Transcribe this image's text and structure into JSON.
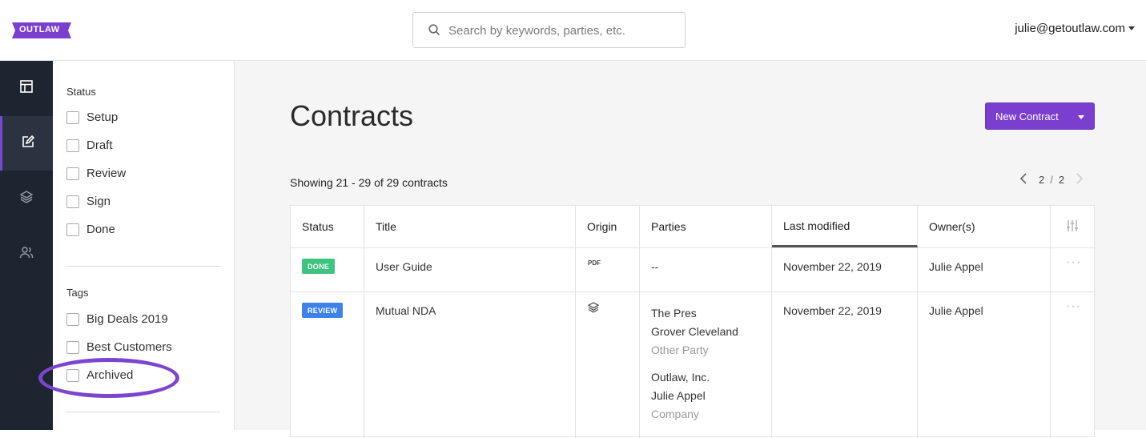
{
  "brand": {
    "name": "OUTLAW",
    "color": "#7b3fd0"
  },
  "search": {
    "placeholder": "Search by keywords, parties, etc.",
    "icon": "search-icon"
  },
  "user": {
    "email": "julie@getoutlaw.com"
  },
  "rail": {
    "items": [
      {
        "icon": "dashboard-icon"
      },
      {
        "icon": "edit-icon",
        "active": true
      },
      {
        "icon": "layers-icon"
      },
      {
        "icon": "users-icon"
      }
    ]
  },
  "filters": {
    "status_title": "Status",
    "status": [
      "Setup",
      "Draft",
      "Review",
      "Sign",
      "Done"
    ],
    "tags_title": "Tags",
    "tags": [
      "Big Deals 2019",
      "Best Customers",
      "Archived"
    ]
  },
  "main": {
    "title": "Contracts",
    "new_button": "New Contract",
    "showing": "Showing 21 - 29 of 29 contracts",
    "page_current": "2",
    "page_sep": "/",
    "page_total": "2"
  },
  "table": {
    "headers": {
      "status": "Status",
      "title": "Title",
      "origin": "Origin",
      "parties": "Parties",
      "modified": "Last modified",
      "owners": "Owner(s)"
    },
    "rows": [
      {
        "status": "DONE",
        "status_color": "#3ec47f",
        "title": "User Guide",
        "origin": "PDF",
        "parties": "--",
        "modified": "November 22, 2019",
        "owner": "Julie Appel"
      },
      {
        "status": "REVIEW",
        "status_color": "#3d82e8",
        "title": "Mutual NDA",
        "origin_icon": "layers-icon",
        "party1_name": "The Pres",
        "party1_person": "Grover Cleveland",
        "party1_role": "Other Party",
        "party2_name": "Outlaw, Inc.",
        "party2_person": "Julie Appel",
        "party2_role": "Company",
        "modified": "November 22, 2019",
        "owner": "Julie Appel"
      }
    ]
  }
}
